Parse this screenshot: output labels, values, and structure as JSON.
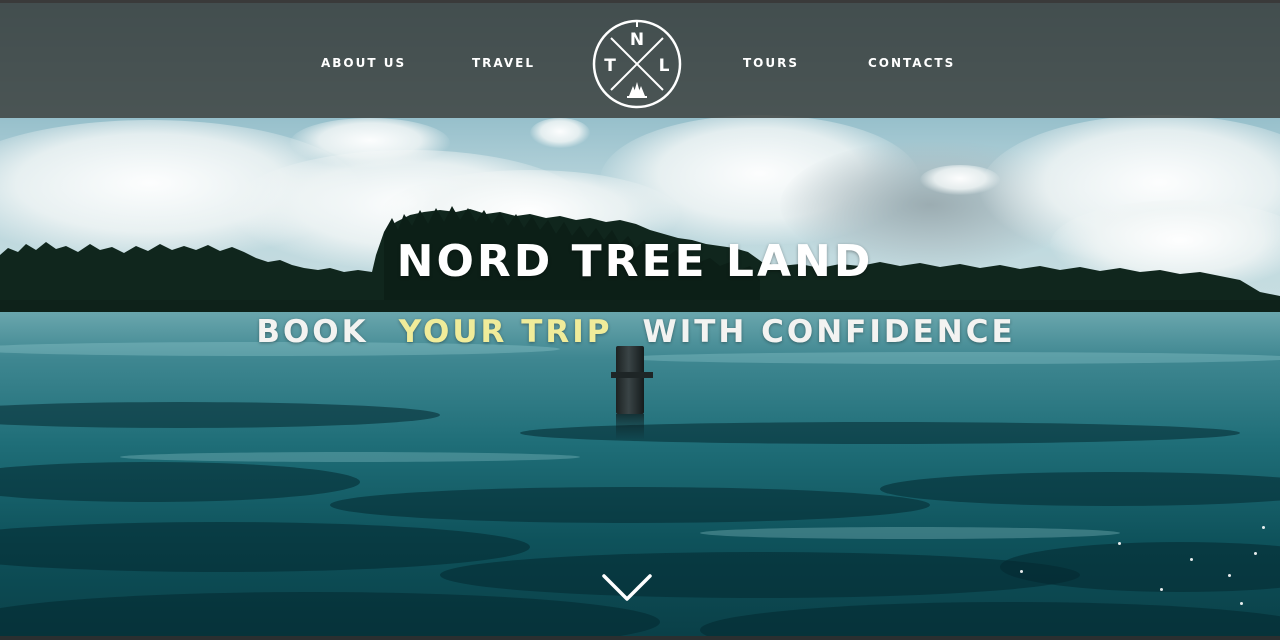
{
  "nav": {
    "left_items": [
      {
        "label": "ABOUT US"
      },
      {
        "label": "TRAVEL"
      }
    ],
    "right_items": [
      {
        "label": "TOURS"
      },
      {
        "label": "CONTACTS"
      }
    ],
    "logo": {
      "letters": [
        "N",
        "T",
        "L"
      ],
      "icon": "compass-trees-logo-icon"
    }
  },
  "hero": {
    "title": "NORD TREE LAND",
    "tagline_start": "BOOK",
    "tagline_highlight": "YOUR TRIP",
    "tagline_end": "WITH CONFIDENCE",
    "scroll_icon": "chevron-down-icon"
  },
  "colors": {
    "nav_background": "#3e4240",
    "text": "#ffffff",
    "highlight": "#f0ec9a",
    "water": "#1f6e78"
  }
}
